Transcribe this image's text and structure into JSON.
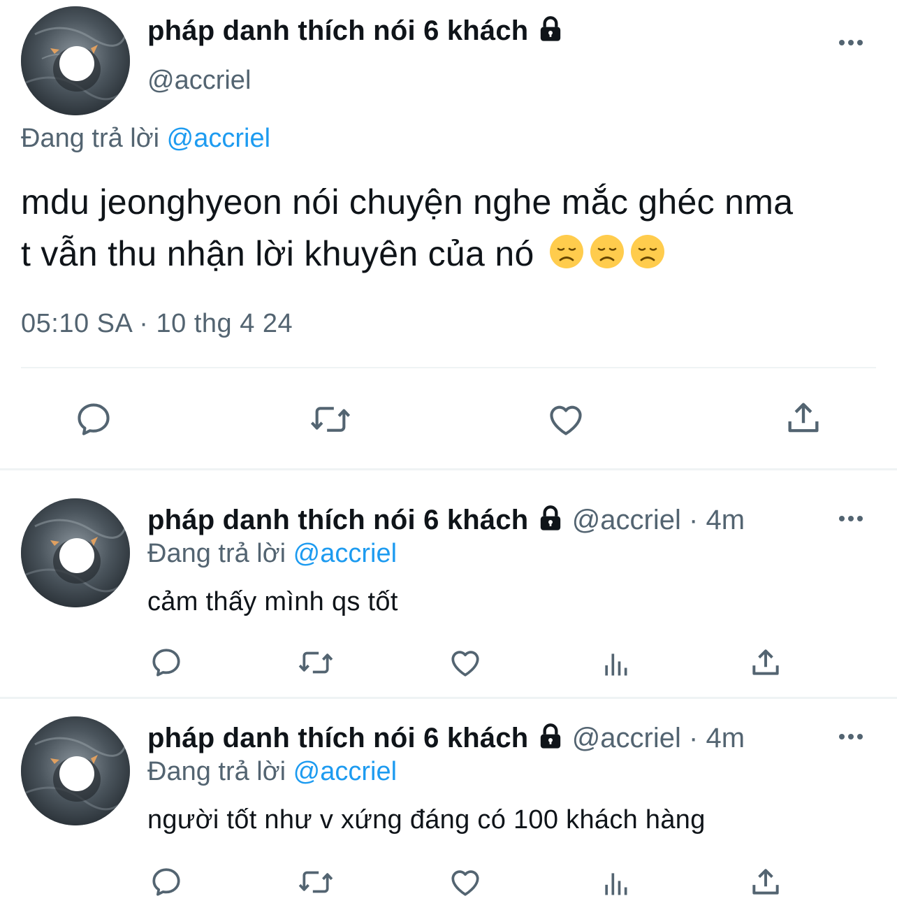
{
  "main_tweet": {
    "display_name": "pháp danh thích nói 6 khách",
    "handle": "@accriel",
    "replying_prefix": "Đang trả lời",
    "replying_to": "@accriel",
    "text_line1": "mdu jeonghyeon nói chuyện nghe mắc ghéc nma",
    "text_line2": "t vẫn thu nhận lời khuyên của nó",
    "emojis": [
      "disappointed-face",
      "disappointed-face",
      "disappointed-face"
    ],
    "timestamp": "05:10 SA · 10 thg 4 24",
    "actions": [
      "reply-icon",
      "retweet-icon",
      "like-icon",
      "share-icon"
    ]
  },
  "replies": [
    {
      "display_name": "pháp danh thích nói 6 khách",
      "meta": "@accriel · 4m",
      "replying_prefix": "Đang trả lời",
      "replying_to": "@accriel",
      "text": "cảm thấy mình qs tốt",
      "actions": [
        "reply-icon",
        "retweet-icon",
        "like-icon",
        "analytics-icon",
        "share-icon"
      ]
    },
    {
      "display_name": "pháp danh thích nói 6 khách",
      "meta": "@accriel · 4m",
      "replying_prefix": "Đang trả lời",
      "replying_to": "@accriel",
      "text": "người tốt như v xứng đáng có 100 khách hàng",
      "actions": [
        "reply-icon",
        "retweet-icon",
        "like-icon",
        "analytics-icon",
        "share-icon"
      ]
    }
  ],
  "colors": {
    "text": "#0f1419",
    "muted": "#536471",
    "link": "#1d9bf0",
    "divider": "#eff3f4"
  }
}
